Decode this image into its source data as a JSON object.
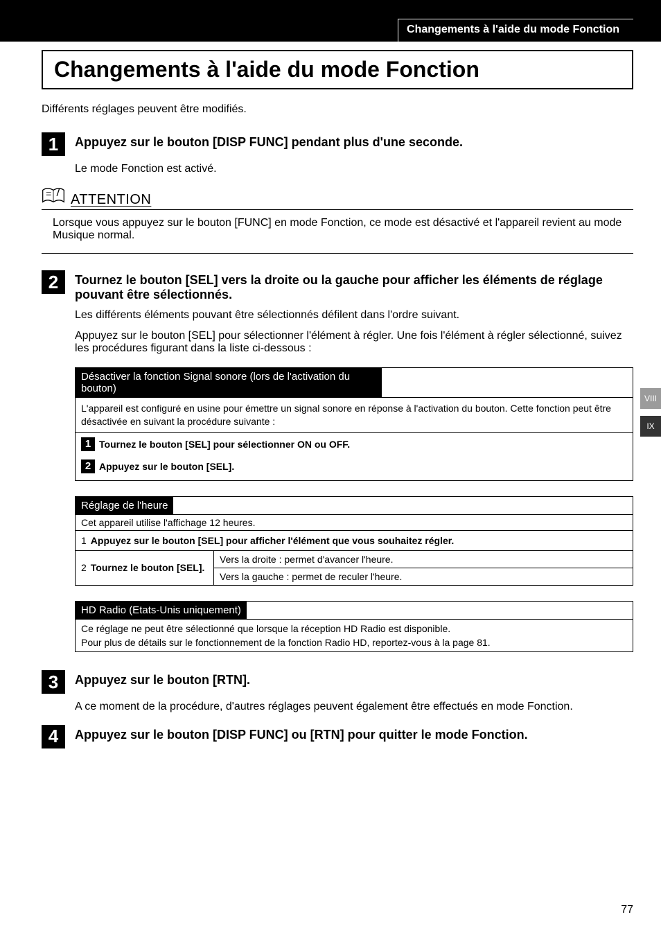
{
  "header": {
    "breadcrumb": "Changements à l'aide du mode Fonction"
  },
  "title": "Changements à l'aide du mode Fonction",
  "intro": "Différents réglages peuvent être modifiés.",
  "step1": {
    "num": "1",
    "title": "Appuyez sur le bouton [DISP FUNC] pendant plus d'une seconde.",
    "body": "Le mode Fonction est activé."
  },
  "attention": {
    "label": "ATTENTION",
    "body": "Lorsque vous appuyez sur le bouton [FUNC] en mode Fonction, ce mode est désactivé et l'appareil revient au mode Musique normal."
  },
  "step2": {
    "num": "2",
    "title": "Tournez le bouton [SEL] vers la droite ou la gauche pour afficher les éléments de réglage pouvant être sélectionnés.",
    "body1": "Les différents éléments pouvant être sélectionnés défilent dans l'ordre suivant.",
    "body2": "Appuyez sur le bouton [SEL] pour sélectionner l'élément à régler.  Une fois l'élément à régler sélectionné, suivez les procédures figurant dans la liste ci-dessous :"
  },
  "beep_section": {
    "header": "Désactiver la fonction Signal sonore (lors de l'activation du bouton)",
    "desc": "L'appareil est configuré en usine pour émettre un signal sonore en réponse à l'activation du bouton. Cette fonction peut être désactivée en suivant la procédure suivante :",
    "s1_num": "1",
    "s1": "Tournez le bouton [SEL] pour sélectionner ON ou OFF.",
    "s2_num": "2",
    "s2": "Appuyez sur le bouton [SEL]."
  },
  "time_section": {
    "header": "Réglage de l'heure",
    "desc": "Cet appareil utilise l'affichage 12 heures.",
    "s1_num": "1",
    "s1": "Appuyez sur le bouton [SEL] pour afficher l'élément que vous souhaitez régler.",
    "s2_num": "2",
    "s2_left": "Tournez le bouton [SEL].",
    "s2_right_top": "Vers la droite : permet d'avancer l'heure.",
    "s2_right_bot": "Vers la gauche : permet de reculer l'heure."
  },
  "hd_section": {
    "header": "HD Radio (Etats-Unis uniquement)",
    "line1": "Ce réglage ne peut être sélectionné que lorsque la réception HD Radio est disponible.",
    "line2": "Pour plus de détails sur le fonctionnement de la fonction Radio HD, reportez-vous à la page 81."
  },
  "step3": {
    "num": "3",
    "title": "Appuyez sur le bouton [RTN].",
    "body": "A ce moment de la procédure, d'autres réglages peuvent également être effectués en mode Fonction."
  },
  "step4": {
    "num": "4",
    "title": "Appuyez sur le bouton [DISP FUNC] ou [RTN] pour quitter le mode Fonction."
  },
  "tabs": {
    "t1": "VIII",
    "t2": "IX"
  },
  "page_number": "77"
}
